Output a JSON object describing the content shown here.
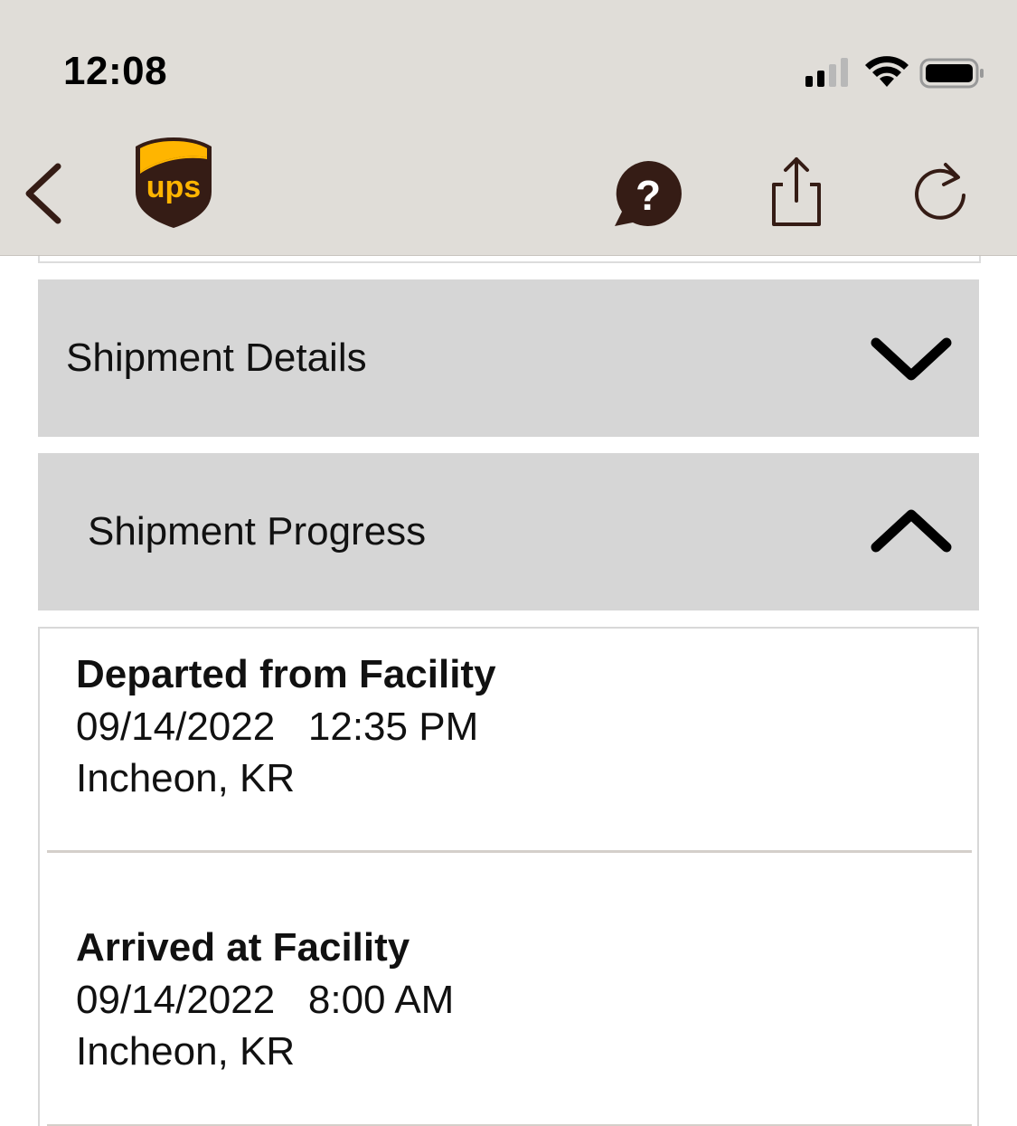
{
  "status_bar": {
    "time": "12:08",
    "icons": [
      "cellular-signal-icon",
      "wifi-icon",
      "battery-icon"
    ]
  },
  "nav_bar": {
    "logo_text": "ups",
    "icons": [
      "back-chevron-icon",
      "ups-logo",
      "help-chat-icon",
      "share-icon",
      "refresh-icon"
    ]
  },
  "colors": {
    "ups_brown": "#351c15",
    "ups_gold": "#ffb500",
    "header_bg": "#e0ddd8",
    "accordion_bg": "#d6d6d6"
  },
  "sections": {
    "details": {
      "title": "Shipment Details",
      "expanded": false
    },
    "progress": {
      "title": "Shipment Progress",
      "expanded": true
    }
  },
  "progress_events": [
    {
      "title": "Departed from Facility",
      "datetime": "09/14/2022   12:35 PM",
      "location": "Incheon, KR"
    },
    {
      "title": "Arrived at Facility",
      "datetime": "09/14/2022   8:00 AM",
      "location": "Incheon, KR"
    }
  ]
}
